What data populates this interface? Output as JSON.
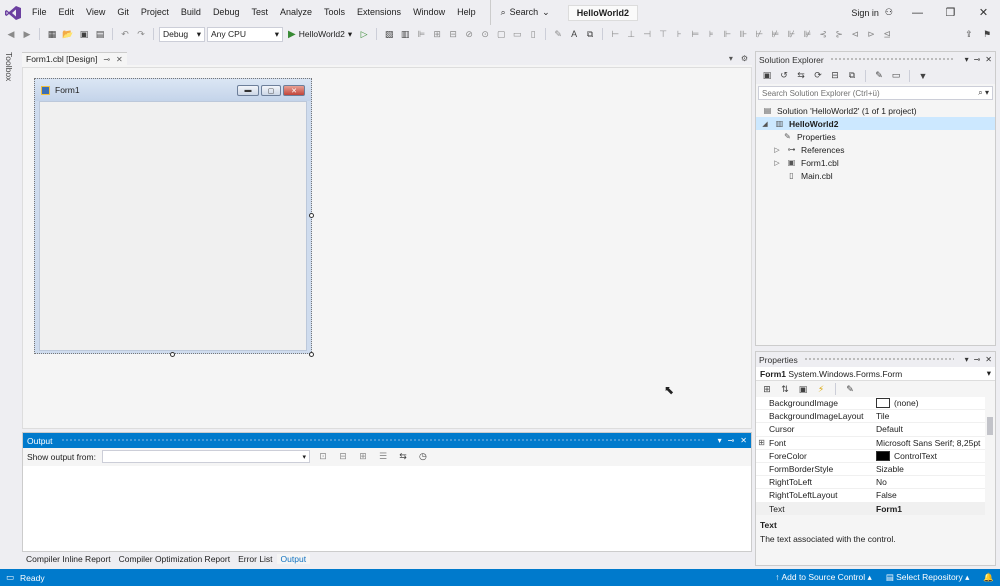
{
  "menubar": {
    "logo": "vs-logo",
    "items": [
      "File",
      "Edit",
      "View",
      "Git",
      "Project",
      "Build",
      "Debug",
      "Test",
      "Analyze",
      "Tools",
      "Extensions",
      "Window",
      "Help"
    ],
    "search_label": "Search",
    "solution_title": "HelloWorld2",
    "signin_label": "Sign in"
  },
  "toolbar": {
    "config": "Debug",
    "platform": "Any CPU",
    "run_target": "HelloWorld2"
  },
  "toolbox_label": "Toolbox",
  "doc_tab": {
    "title": "Form1.cbl [Design]"
  },
  "designer": {
    "form_title": "Form1"
  },
  "output": {
    "title": "Output",
    "show_from_label": "Show output from:",
    "show_from_value": ""
  },
  "bottom_tabs": [
    "Compiler Inline Report",
    "Compiler Optimization Report",
    "Error List",
    "Output"
  ],
  "solution_explorer": {
    "title": "Solution Explorer",
    "search_placeholder": "Search Solution Explorer (Ctrl+ü)",
    "solution_label": "Solution 'HelloWorld2' (1 of 1 project)",
    "project_label": "HelloWorld2",
    "nodes": [
      "Properties",
      "References",
      "Form1.cbl",
      "Main.cbl"
    ]
  },
  "properties": {
    "title": "Properties",
    "object_name": "Form1",
    "object_type": "System.Windows.Forms.Form",
    "rows": [
      {
        "name": "BackgroundImage",
        "value": "(none)"
      },
      {
        "name": "BackgroundImageLayout",
        "value": "Tile"
      },
      {
        "name": "Cursor",
        "value": "Default"
      },
      {
        "name": "Font",
        "value": "Microsoft Sans Serif; 8,25pt"
      },
      {
        "name": "ForeColor",
        "value": "ControlText"
      },
      {
        "name": "FormBorderStyle",
        "value": "Sizable"
      },
      {
        "name": "RightToLeft",
        "value": "No"
      },
      {
        "name": "RightToLeftLayout",
        "value": "False"
      },
      {
        "name": "Text",
        "value": "Form1"
      }
    ],
    "desc_title": "Text",
    "desc_text": "The text associated with the control."
  },
  "statusbar": {
    "status": "Ready",
    "source_control": "Add to Source Control",
    "repository": "Select Repository"
  },
  "colors": {
    "accent": "#007acc",
    "chrome": "#eeeef2"
  }
}
